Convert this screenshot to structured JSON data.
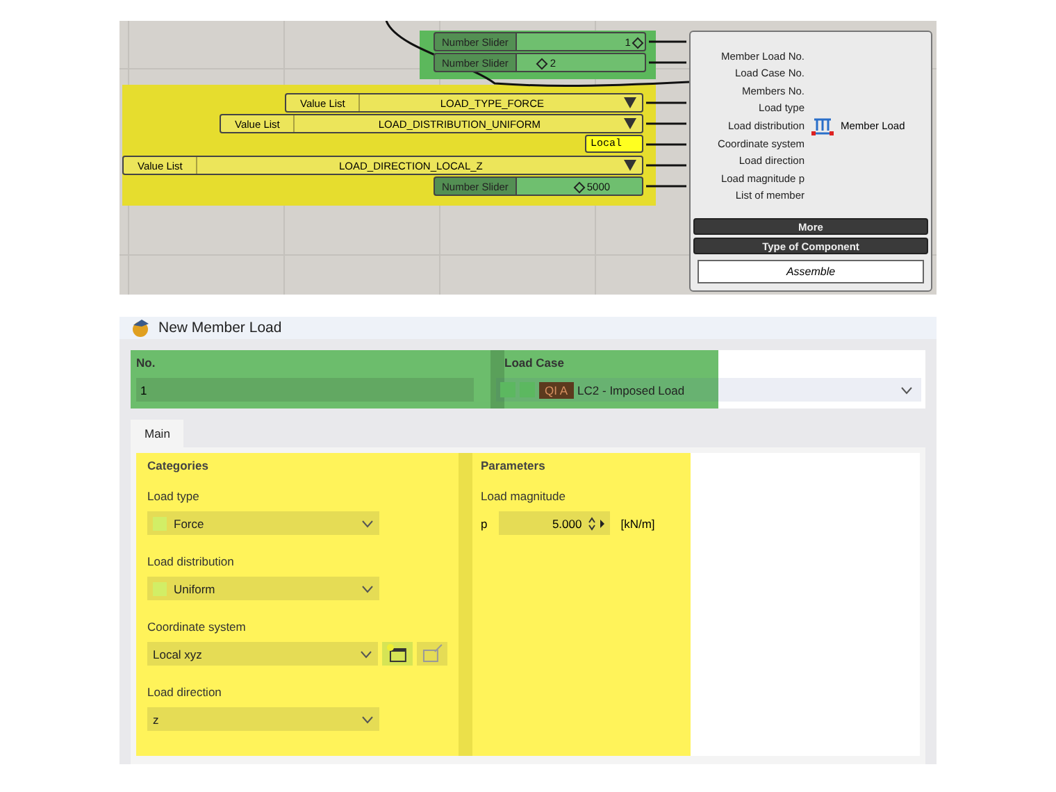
{
  "canvas": {
    "groups": [
      {
        "color": "#5cb85c",
        "nodes": [
          {
            "kind": "slider",
            "label": "Number Slider",
            "value": "1",
            "level": 0.95
          },
          {
            "kind": "slider",
            "label": "Number Slider",
            "value": "2",
            "level": 0.2
          }
        ]
      },
      {
        "color": "#e6dd2e",
        "nodes": [
          {
            "kind": "list",
            "label": "Value List",
            "value": "LOAD_TYPE_FORCE"
          },
          {
            "kind": "list",
            "label": "Value List",
            "value": "LOAD_DISTRIBUTION_UNIFORM"
          },
          {
            "kind": "panel",
            "value": "Local"
          },
          {
            "kind": "list",
            "label": "Value List",
            "value": "LOAD_DIRECTION_LOCAL_Z"
          },
          {
            "kind": "slider",
            "label": "Number Slider",
            "value": "5000",
            "level": 0.5
          }
        ]
      }
    ],
    "component": {
      "inputs": [
        "Member Load No.",
        "Load Case No.",
        "Members No.",
        "Load type",
        "Load distribution",
        "Coordinate system",
        "Load direction",
        "Load magnitude p",
        "List of member"
      ],
      "output": "Member Load",
      "buttons": [
        "More",
        "Type of Component"
      ],
      "mode": "Assemble"
    }
  },
  "dialog": {
    "title": "New Member Load",
    "header": {
      "no_label": "No.",
      "no_value": "1",
      "load_case_label": "Load Case",
      "load_case_tag": "QI A",
      "load_case_value": "LC2 - Imposed Load"
    },
    "tabs": [
      {
        "label": "Main",
        "selected": true
      }
    ],
    "categories": {
      "title": "Categories",
      "fields": [
        {
          "kind": "swatch",
          "label": "Load type",
          "value": "Force"
        },
        {
          "kind": "swatch",
          "label": "Load distribution",
          "value": "Uniform"
        },
        {
          "kind": "tools",
          "label": "Coordinate system",
          "value": "Local xyz"
        },
        {
          "kind": "plain",
          "label": "Load direction",
          "value": "z"
        }
      ]
    },
    "parameters": {
      "title": "Parameters",
      "label": "Load magnitude",
      "symbol": "p",
      "value": "5.000",
      "unit": "[kN/m]"
    }
  }
}
